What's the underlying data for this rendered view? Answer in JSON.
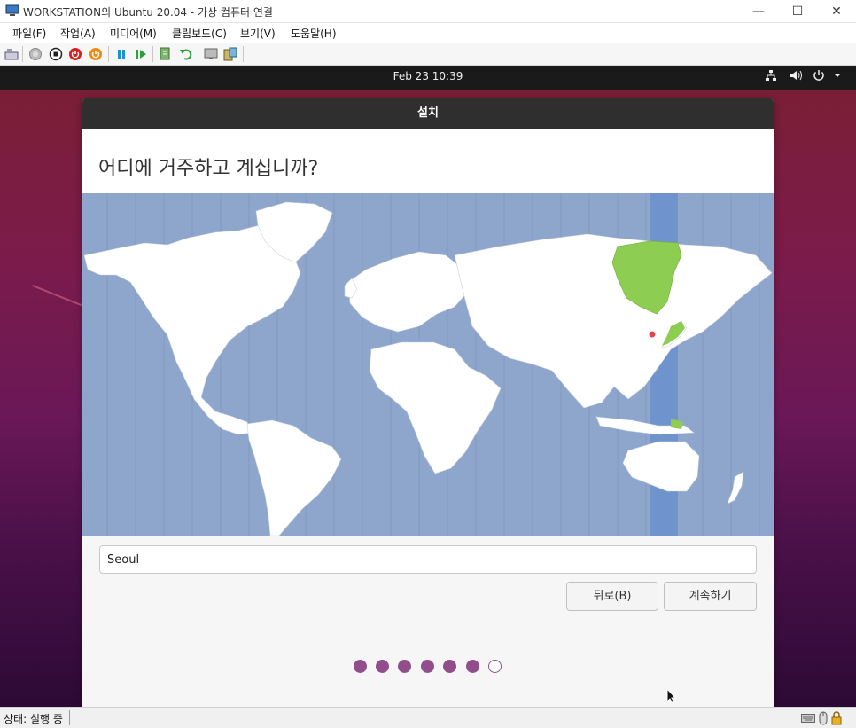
{
  "window": {
    "title": "WORKSTATION의 Ubuntu 20.04 - 가상 컴퓨터 연결",
    "controls": {
      "minimize": "—",
      "maximize": "☐",
      "close": "✕"
    }
  },
  "menu": [
    "파일(F)",
    "작업(A)",
    "미디어(M)",
    "클립보드(C)",
    "보기(V)",
    "도움말(H)"
  ],
  "toolbar": {
    "icons": [
      "ctrl-alt-del-icon",
      "start-icon",
      "turn-off-icon",
      "shutdown-icon",
      "save-icon",
      "pause-icon",
      "resume-icon",
      "checkpoint-icon",
      "revert-icon",
      "enhanced-session-icon",
      "share-icon"
    ]
  },
  "vm": {
    "clock": "Feb 23  10:39",
    "tray_icons": [
      "network-icon",
      "volume-icon",
      "power-icon",
      "dropdown-arrow-icon"
    ]
  },
  "installer": {
    "title": "설치",
    "heading": "어디에 거주하고 계십니까?",
    "timezone_value": "Seoul",
    "back_label": "뒤로(B)",
    "continue_label": "계속하기",
    "progress": {
      "total_steps": 7,
      "completed_steps": 6
    }
  },
  "statusbar": {
    "status": "상태: 실행 중"
  },
  "colors": {
    "accent": "#924d8b",
    "map_ocean": "#8ea6cc",
    "selected_timezone_band": "#6f93cc",
    "selected_region": "#8dce52",
    "header_dark": "#2f2f2f"
  }
}
